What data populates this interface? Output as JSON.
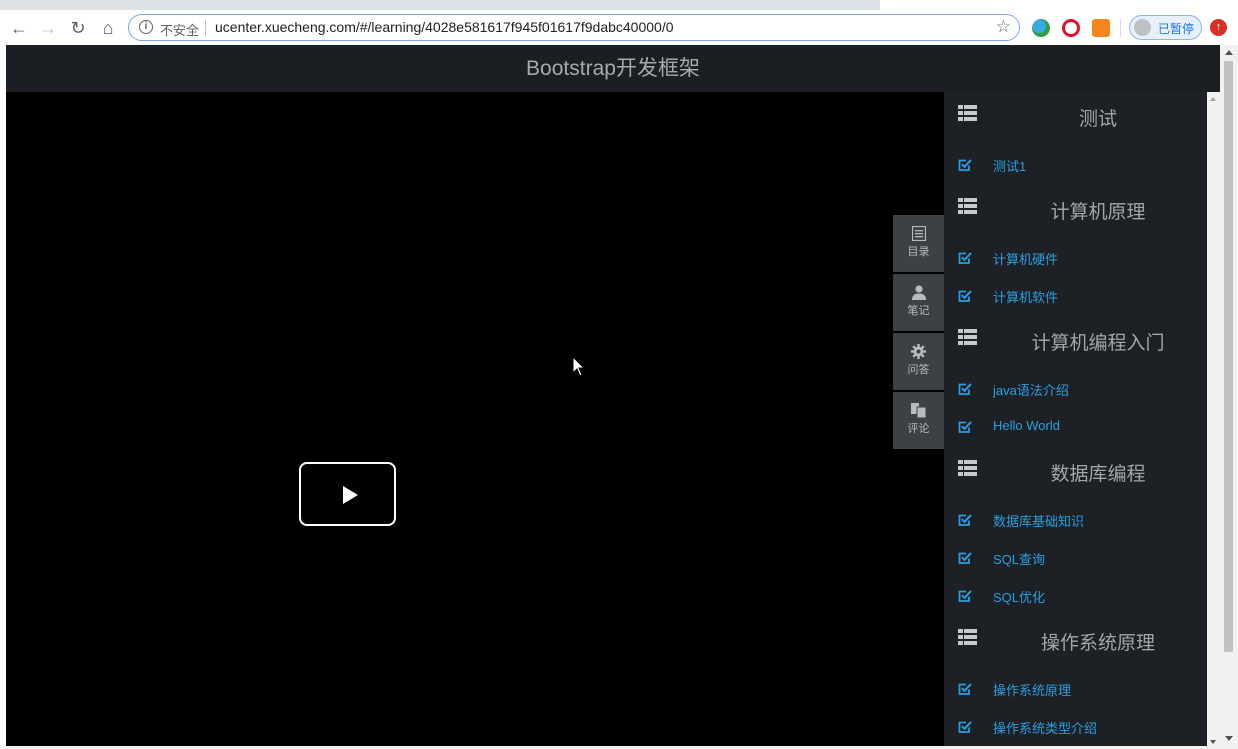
{
  "browser": {
    "security_label": "不安全",
    "url": "ucenter.xuecheng.com/#/learning/4028e581617f945f01617f9dabc40000/0",
    "profile_status": "已暂停",
    "icons": {
      "back": "arrow-left-icon",
      "forward": "arrow-right-icon",
      "reload": "reload-icon",
      "home": "home-icon",
      "info": "info-icon",
      "bookmark": "star-icon",
      "update": "update-icon"
    }
  },
  "page": {
    "header_title": "Bootstrap开发框架"
  },
  "side_tabs": [
    {
      "label": "目录",
      "icon": "list-alt-icon"
    },
    {
      "label": "笔记",
      "icon": "user-icon"
    },
    {
      "label": "问答",
      "icon": "gear-icon"
    },
    {
      "label": "评论",
      "icon": "copy-icon"
    }
  ],
  "course_outline": [
    {
      "chapter": "测试",
      "lessons": [
        "测试1"
      ]
    },
    {
      "chapter": "计算机原理",
      "lessons": [
        "计算机硬件",
        "计算机软件"
      ]
    },
    {
      "chapter": "计算机编程入门",
      "lessons": [
        "java语法介绍",
        "Hello World"
      ]
    },
    {
      "chapter": "数据库编程",
      "lessons": [
        "数据库基础知识",
        "SQL查询",
        "SQL优化"
      ]
    },
    {
      "chapter": "操作系统原理",
      "lessons": [
        "操作系统原理",
        "操作系统类型介绍"
      ]
    }
  ],
  "colors": {
    "lesson_link": "#2a9fe0",
    "sidebar_bg": "#1d2024",
    "header_bg": "#1b1e22"
  }
}
